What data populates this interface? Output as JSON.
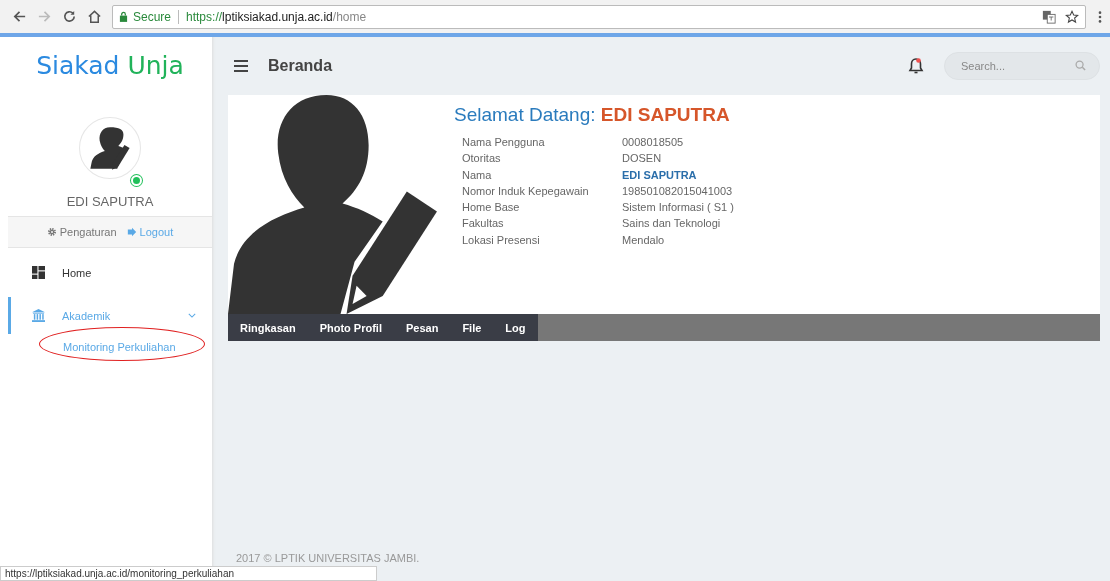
{
  "browser": {
    "secure_label": "Secure",
    "url": {
      "scheme": "https://",
      "host": "lptiksiakad.unja.ac.id",
      "path": "/home"
    },
    "status_url": "https://lptiksiakad.unja.ac.id/monitoring_perkuliahan"
  },
  "sidebar": {
    "logo": [
      "Siakad",
      "Unja"
    ],
    "user_name": "EDI SAPUTRA",
    "online": true,
    "links": [
      "Pengaturan",
      "Logout"
    ],
    "items": [
      {
        "label": "Home",
        "active": false
      },
      {
        "label": "Akademik",
        "expanded": true,
        "active": true,
        "children": [
          {
            "label": "Monitoring Perkuliahan",
            "circled": true
          }
        ]
      }
    ]
  },
  "header": {
    "title": "Beranda",
    "notification": true,
    "search": {
      "placeholder": "Search..."
    }
  },
  "profile": {
    "greeting": "Selamat Datang:",
    "name": "EDI SAPUTRA",
    "fields": [
      {
        "label": "Nama Pengguna",
        "value": "0008018505",
        "emphasis": false
      },
      {
        "label": "Otoritas",
        "value": "DOSEN",
        "emphasis": false
      },
      {
        "label": "Nama",
        "value": "EDI SAPUTRA",
        "emphasis": true
      },
      {
        "label": "Nomor Induk Kepegawain",
        "value": "198501082015041003",
        "emphasis": false
      },
      {
        "label": "Home Base",
        "value": "Sistem Informasi ( S1 )",
        "emphasis": false
      },
      {
        "label": "Fakultas",
        "value": "Sains dan Teknologi",
        "emphasis": false
      },
      {
        "label": "Lokasi Presensi",
        "value": "Mendalo",
        "emphasis": false
      }
    ],
    "tabs": [
      "Ringkasan",
      "Photo Profil",
      "Pesan",
      "File",
      "Log"
    ]
  },
  "footer": "2017 © LPTIK UNIVERSITAS JAMBI."
}
